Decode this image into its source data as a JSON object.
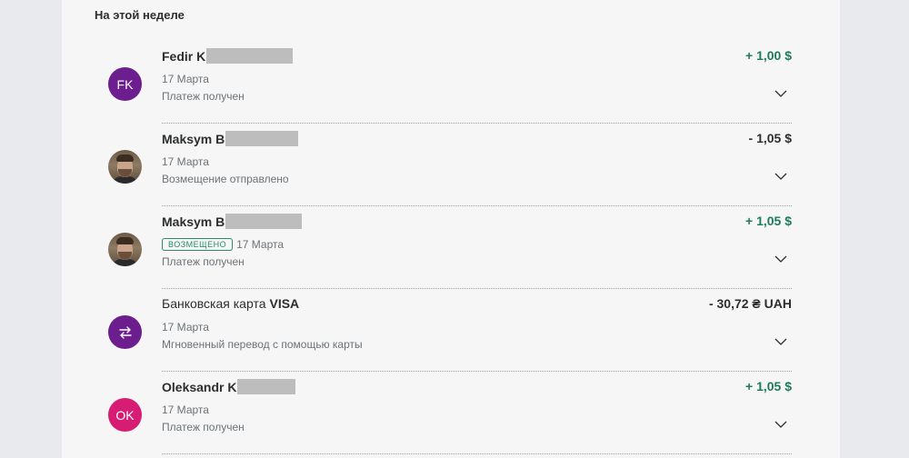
{
  "section": {
    "title": "На этой неделе"
  },
  "transactions": [
    {
      "avatar_initials": "FK",
      "name": "Fedir K",
      "date": "17 Марта",
      "status": "Платеж получен",
      "amount": "+ 1,00 $"
    },
    {
      "avatar_icon": "user-photo-icon",
      "name": "Maksym B",
      "date": "17 Марта",
      "status": "Возмещение отправлено",
      "amount": "- 1,05 $"
    },
    {
      "avatar_icon": "user-photo-icon",
      "name": "Maksym B",
      "badge": "ВОЗМЕЩЕНО",
      "date": "17 Марта",
      "status": "Платеж получен",
      "amount": "+ 1,05 $"
    },
    {
      "avatar_icon": "transfer-arrows-icon",
      "name_prefix": "Банковская карта",
      "name": "VISA",
      "date": "17 Марта",
      "status": "Мгновенный перевод с помощью карты",
      "amount": "- 30,72 ₴ UAH"
    },
    {
      "avatar_initials": "OK",
      "name": "Oleksandr K",
      "date": "17 Марта",
      "status": "Платеж получен",
      "amount": "+ 1,05 $"
    }
  ],
  "colors": {
    "positive_amount": "#1e7a5e",
    "purple_avatar": "#6c1d8e",
    "pink_avatar": "#d61d73"
  }
}
